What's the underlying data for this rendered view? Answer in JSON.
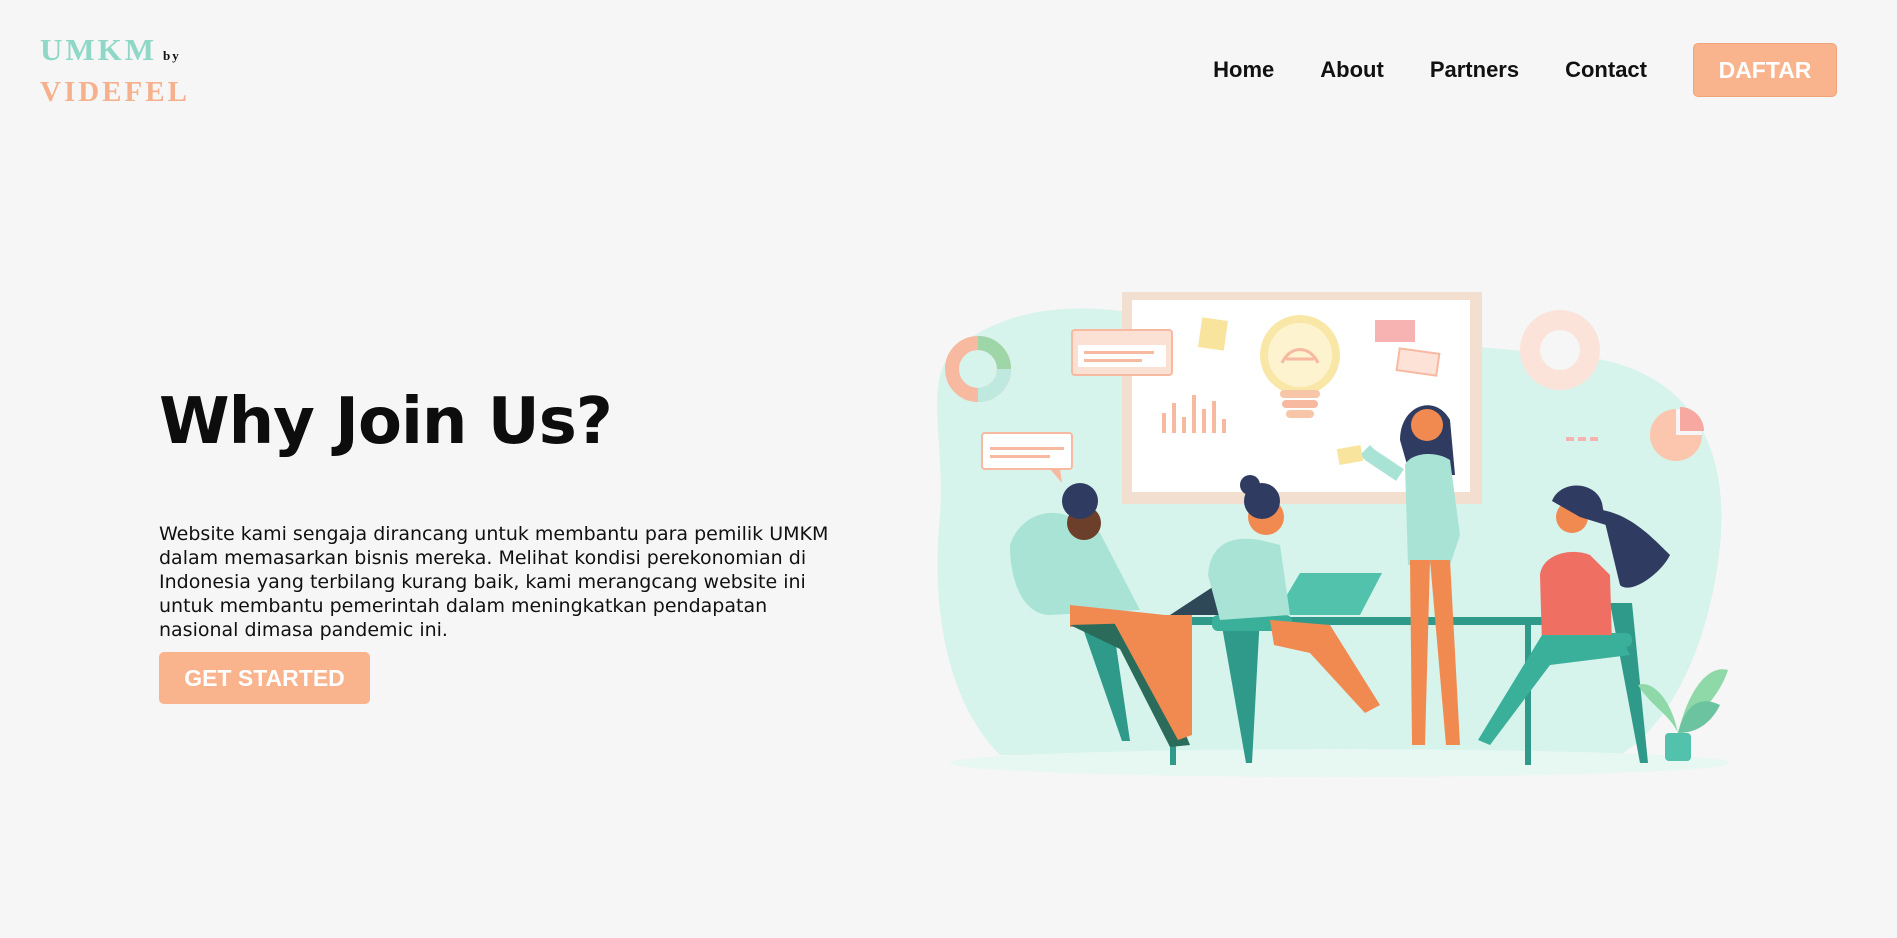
{
  "brand": {
    "line1": "UMKM",
    "by": "by",
    "line2": "VIDEFEL"
  },
  "nav": {
    "links": [
      "Home",
      "About",
      "Partners",
      "Contact"
    ],
    "cta": "DAFTAR"
  },
  "hero": {
    "title": "Why Join Us?",
    "description": "Website kami sengaja dirancang untuk membantu para pemilik UMKM dalam memasarkan bisnis mereka. Melihat kondisi perekonomian di Indonesia yang terbilang kurang baik, kami merangcang website ini untuk membantu pemerintah dalam meningkatkan pendapatan nasional dimasa pandemic ini.",
    "button": "GET STARTED"
  },
  "colors": {
    "accent": "#f9b38d",
    "mint": "#8fd8c8",
    "text": "#111111"
  },
  "illustration": {
    "icon": "team-meeting-illustration"
  }
}
